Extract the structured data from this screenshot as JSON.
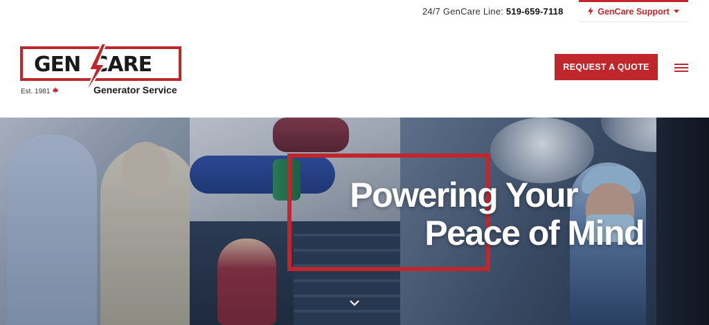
{
  "topbar": {
    "phone_label": "24/7 GenCare Line:",
    "phone_number": "519-659-7118",
    "support_label": "GenCare Support"
  },
  "logo": {
    "wordmark_left": "GEN",
    "wordmark_right": "CARE",
    "established": "Est. 1981",
    "subtitle": "Generator Service"
  },
  "header": {
    "quote_button": "REQUEST A QUOTE"
  },
  "hero": {
    "headline_line1": "Powering Your",
    "headline_line2": "Peace of Mind"
  },
  "colors": {
    "brand_red": "#c0272d",
    "text_dark": "#1a1a1a"
  },
  "icons": [
    "bolt-icon",
    "chevron-down-icon",
    "maple-leaf-icon",
    "hamburger-menu-icon",
    "scroll-down-chevron-icon"
  ]
}
